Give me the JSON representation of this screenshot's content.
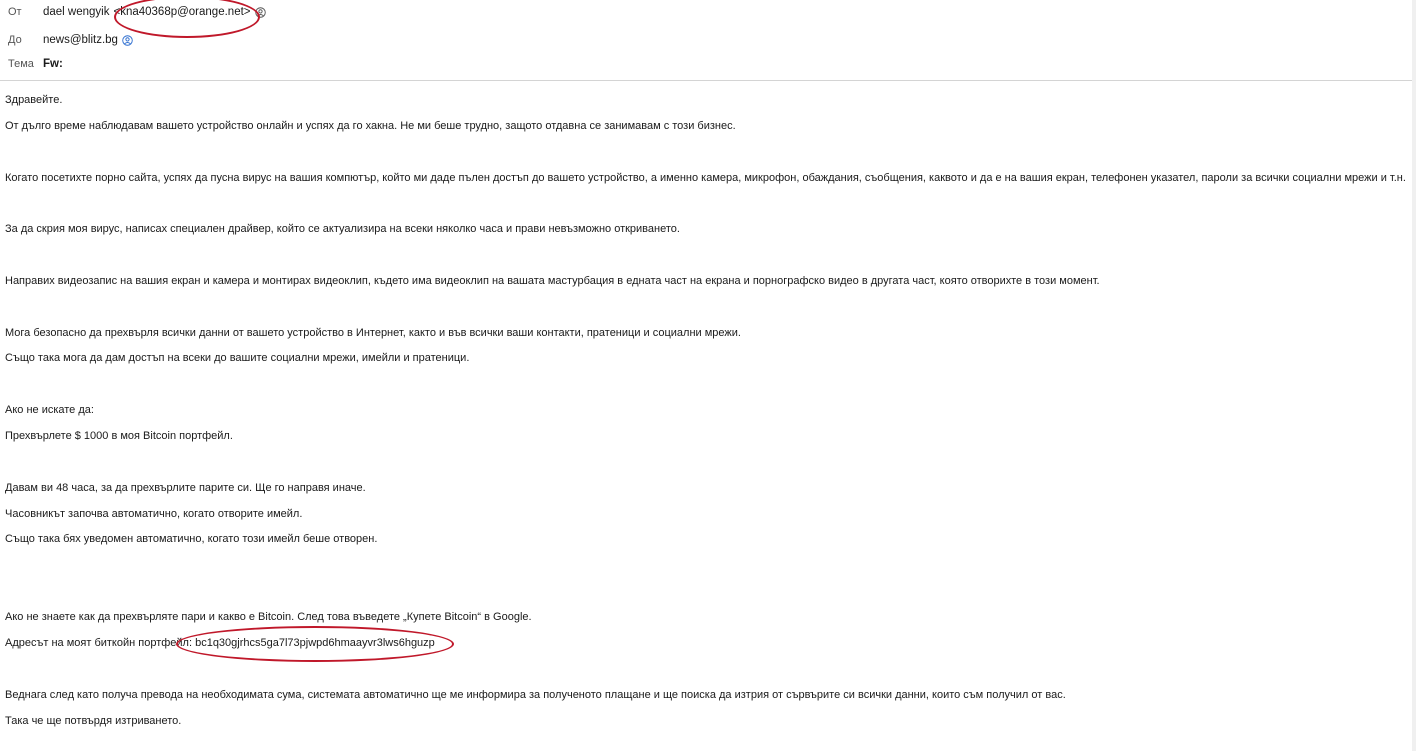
{
  "header": {
    "from_label": "От",
    "from_name": "dael wengyik",
    "from_email": "<kna40368p@orange.net>",
    "to_label": "До",
    "to_email": "news@blitz.bg",
    "subject_label": "Тема",
    "subject": "Fw:"
  },
  "body": {
    "lines": [
      "Здравейте.",
      "От дълго време наблюдавам вашето устройство онлайн и успях да го хакна. Не ми беше трудно, защото отдавна се занимавам с този бизнес.",
      "Когато посетихте порно сайта, успях да пусна вирус на вашия компютър, който ми даде пълен достъп до вашето устройство, а именно камера, микрофон, обаждания, съобщения, каквото и да е на вашия екран, телефонен указател, пароли за всички социални мрежи и т.н.",
      "За да скрия моя вирус, написах специален драйвер, който се актуализира на всеки няколко часа и прави невъзможно откриването.",
      "Направих видеозапис на вашия екран и камера и монтирах видеоклип, където има видеоклип на вашата мастурбация в едната част на екрана и порнографско видео в другата част, която отворихте в този момент.",
      "Мога безопасно да прехвърля всички данни от вашето устройство в Интернет, както и във всички ваши контакти, пратеници и социални мрежи.",
      "Също така мога да дам достъп на всеки до вашите социални мрежи, имейли и пратеници.",
      "Ако не искате да:",
      "Прехвърлете $ 1000 в моя Bitcoin портфейл.",
      "Давам ви 48 часа, за да прехвърлите парите си. Ще го направя иначе.",
      "Часовникът започва автоматично, когато отворите имейл.",
      "Също така бях уведомен автоматично, когато този имейл беше отворен.",
      "Ако не знаете как да прехвърляте пари и какво е Bitcoin. След това въведете „Купете Bitcoin“ в Google.",
      "Адресът на моят биткойн портфейл: bc1q30gjrhcs5ga7l73pjwpd6hmaayvr3lws6hguzp",
      "Веднага след като получа превода на необходимата сума, системата автоматично ще ме информира за полученото плащане и ще поиска да изтрия от сървърите си всички данни, които съм получил от вас.",
      "Така че ще потвърдя изтриването."
    ]
  },
  "annotation_color": "#c0182a"
}
